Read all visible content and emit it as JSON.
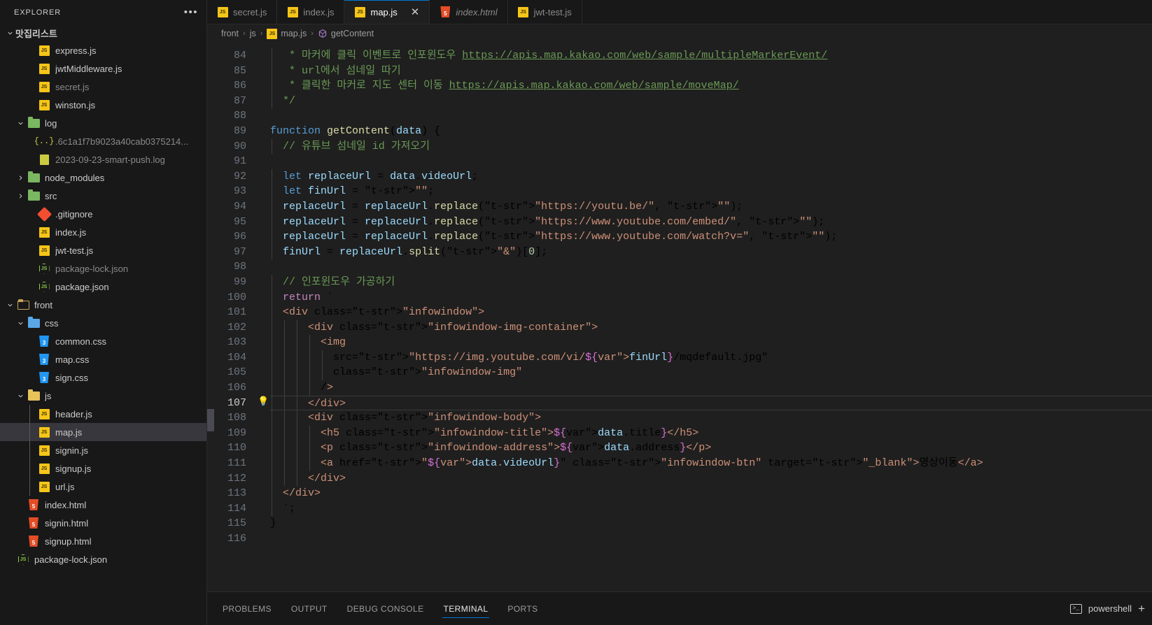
{
  "sidebar": {
    "title": "EXPLORER",
    "more_icon": "ellipsis-icon",
    "root_folder": "맛집리스트",
    "items": [
      {
        "label": "express.js",
        "icon": "js-file-icon",
        "depth": 2,
        "kind": "js",
        "dim": false
      },
      {
        "label": "jwtMiddleware.js",
        "icon": "js-file-icon",
        "depth": 2,
        "kind": "js",
        "dim": false
      },
      {
        "label": "secret.js",
        "icon": "js-file-icon",
        "depth": 2,
        "kind": "js",
        "dim": true
      },
      {
        "label": "winston.js",
        "icon": "js-file-icon",
        "depth": 2,
        "kind": "js",
        "dim": false
      },
      {
        "label": "log",
        "icon": "folder-open-icon",
        "depth": 1,
        "kind": "folder-green",
        "expanded": true,
        "dim": false
      },
      {
        "label": ".6c1a1f7b9023a40cab0375214...",
        "icon": "json-file-icon",
        "depth": 2,
        "kind": "json",
        "dim": true
      },
      {
        "label": "2023-09-23-smart-push.log",
        "icon": "log-file-icon",
        "depth": 2,
        "kind": "log",
        "dim": true
      },
      {
        "label": "node_modules",
        "icon": "folder-icon",
        "depth": 1,
        "kind": "folder-green",
        "expanded": false,
        "dim": false
      },
      {
        "label": "src",
        "icon": "folder-code-icon",
        "depth": 1,
        "kind": "folder-green",
        "expanded": false,
        "dim": false
      },
      {
        "label": ".gitignore",
        "icon": "git-file-icon",
        "depth": 2,
        "kind": "git",
        "dim": false
      },
      {
        "label": "index.js",
        "icon": "js-file-icon",
        "depth": 2,
        "kind": "js",
        "dim": false
      },
      {
        "label": "jwt-test.js",
        "icon": "js-file-icon",
        "depth": 2,
        "kind": "js",
        "dim": false
      },
      {
        "label": "package-lock.json",
        "icon": "npm-file-icon",
        "depth": 2,
        "kind": "npm",
        "dim": true
      },
      {
        "label": "package.json",
        "icon": "npm-file-icon",
        "depth": 2,
        "kind": "npm",
        "dim": false
      },
      {
        "label": "front",
        "icon": "folder-open-icon",
        "depth": 0,
        "kind": "folder-plain",
        "expanded": true,
        "dim": false
      },
      {
        "label": "css",
        "icon": "folder-css-icon",
        "depth": 1,
        "kind": "folder-blue",
        "expanded": true,
        "dim": false
      },
      {
        "label": "common.css",
        "icon": "css-file-icon",
        "depth": 2,
        "kind": "css",
        "dim": false
      },
      {
        "label": "map.css",
        "icon": "css-file-icon",
        "depth": 2,
        "kind": "css",
        "dim": false
      },
      {
        "label": "sign.css",
        "icon": "css-file-icon",
        "depth": 2,
        "kind": "css",
        "dim": false
      },
      {
        "label": "js",
        "icon": "folder-js-icon",
        "depth": 1,
        "kind": "folder-yellow",
        "expanded": true,
        "dim": false
      },
      {
        "label": "header.js",
        "icon": "js-file-icon",
        "depth": 2,
        "kind": "js",
        "dim": false,
        "guide": true
      },
      {
        "label": "map.js",
        "icon": "js-file-icon",
        "depth": 2,
        "kind": "js",
        "dim": false,
        "selected": true,
        "guide": true
      },
      {
        "label": "signin.js",
        "icon": "js-file-icon",
        "depth": 2,
        "kind": "js",
        "dim": false,
        "guide": true
      },
      {
        "label": "signup.js",
        "icon": "js-file-icon",
        "depth": 2,
        "kind": "js",
        "dim": false,
        "guide": true
      },
      {
        "label": "url.js",
        "icon": "js-file-icon",
        "depth": 2,
        "kind": "js",
        "dim": false,
        "guide": true
      },
      {
        "label": "index.html",
        "icon": "html-file-icon",
        "depth": 1,
        "kind": "html",
        "dim": false
      },
      {
        "label": "signin.html",
        "icon": "html-file-icon",
        "depth": 1,
        "kind": "html",
        "dim": false
      },
      {
        "label": "signup.html",
        "icon": "html-file-icon",
        "depth": 1,
        "kind": "html",
        "dim": false
      },
      {
        "label": "package-lock.json",
        "icon": "npm-file-icon",
        "depth": 0,
        "kind": "npm",
        "dim": false
      }
    ]
  },
  "tabs": [
    {
      "label": "secret.js",
      "icon": "js-file-icon",
      "active": false,
      "italic": false,
      "close": ""
    },
    {
      "label": "index.js",
      "icon": "js-file-icon",
      "active": false,
      "italic": false,
      "close": ""
    },
    {
      "label": "map.js",
      "icon": "js-file-icon",
      "active": true,
      "italic": false,
      "close": "✕"
    },
    {
      "label": "index.html",
      "icon": "html-file-icon",
      "active": false,
      "italic": true,
      "close": ""
    },
    {
      "label": "jwt-test.js",
      "icon": "js-file-icon",
      "active": false,
      "italic": false,
      "close": ""
    }
  ],
  "breadcrumb": {
    "sep": "›",
    "parts": [
      {
        "label": "front",
        "icon": ""
      },
      {
        "label": "js",
        "icon": ""
      },
      {
        "label": "map.js",
        "icon": "js-file-icon"
      },
      {
        "label": "getContent",
        "icon": "symbol-function-icon"
      }
    ]
  },
  "editor": {
    "first_line": 84,
    "current_line": 107,
    "lightbulb_line": 107,
    "lightbulb_icon": "lightbulb-icon",
    "lines": [
      {
        "n": 84,
        "text": "   * 마커에 클릭 이벤트로 인포윈도우 https://apis.map.kakao.com/web/sample/multipleMarkerEvent/"
      },
      {
        "n": 85,
        "text": "   * url에서 섬네일 따기"
      },
      {
        "n": 86,
        "text": "   * 클릭한 마커로 지도 센터 이동 https://apis.map.kakao.com/web/sample/moveMap/"
      },
      {
        "n": 87,
        "text": "  */"
      },
      {
        "n": 88,
        "text": ""
      },
      {
        "n": 89,
        "text": "function getContent(data) {"
      },
      {
        "n": 90,
        "text": "  // 유튜브 섬네일 id 가져오기"
      },
      {
        "n": 91,
        "text": ""
      },
      {
        "n": 92,
        "text": "  let replaceUrl = data.videoUrl;"
      },
      {
        "n": 93,
        "text": "  let finUrl = \"\";"
      },
      {
        "n": 94,
        "text": "  replaceUrl = replaceUrl.replace(\"https://youtu.be/\", \"\");"
      },
      {
        "n": 95,
        "text": "  replaceUrl = replaceUrl.replace(\"https://www.youtube.com/embed/\", \"\");"
      },
      {
        "n": 96,
        "text": "  replaceUrl = replaceUrl.replace(\"https://www.youtube.com/watch?v=\", \"\");"
      },
      {
        "n": 97,
        "text": "  finUrl = replaceUrl.split(\"&\")[0];"
      },
      {
        "n": 98,
        "text": ""
      },
      {
        "n": 99,
        "text": "  // 인포윈도우 가공하기"
      },
      {
        "n": 100,
        "text": "  return `"
      },
      {
        "n": 101,
        "text": "  <div class=\"infowindow\">"
      },
      {
        "n": 102,
        "text": "      <div class=\"infowindow-img-container\">"
      },
      {
        "n": 103,
        "text": "        <img"
      },
      {
        "n": 104,
        "text": "          src=\"https://img.youtube.com/vi/${finUrl}/mqdefault.jpg\""
      },
      {
        "n": 105,
        "text": "          class=\"infowindow-img\""
      },
      {
        "n": 106,
        "text": "        />"
      },
      {
        "n": 107,
        "text": "      </div>"
      },
      {
        "n": 108,
        "text": "      <div class=\"infowindow-body\">"
      },
      {
        "n": 109,
        "text": "        <h5 class=\"infowindow-title\">${data.title}</h5>"
      },
      {
        "n": 110,
        "text": "        <p class=\"infowindow-address\">${data.address}</p>"
      },
      {
        "n": 111,
        "text": "        <a href=\"${data.videoUrl}\" class=\"infowindow-btn\" target=\"_blank\">영상이동</a>"
      },
      {
        "n": 112,
        "text": "      </div>"
      },
      {
        "n": 113,
        "text": "  </div>"
      },
      {
        "n": 114,
        "text": "  `;"
      },
      {
        "n": 115,
        "text": "}"
      },
      {
        "n": 116,
        "text": ""
      }
    ]
  },
  "panel": {
    "tabs": [
      {
        "label": "PROBLEMS",
        "active": false
      },
      {
        "label": "OUTPUT",
        "active": false
      },
      {
        "label": "DEBUG CONSOLE",
        "active": false
      },
      {
        "label": "TERMINAL",
        "active": true
      },
      {
        "label": "PORTS",
        "active": false
      }
    ],
    "terminal_name": "powershell",
    "terminal_icon": "powershell-icon",
    "add_label": "+",
    "add_icon": "plus-icon"
  },
  "colors": {
    "accent": "#0078d4",
    "sidebar_bg": "#181818",
    "editor_bg": "#1f1f1f",
    "selection": "#37373d"
  }
}
